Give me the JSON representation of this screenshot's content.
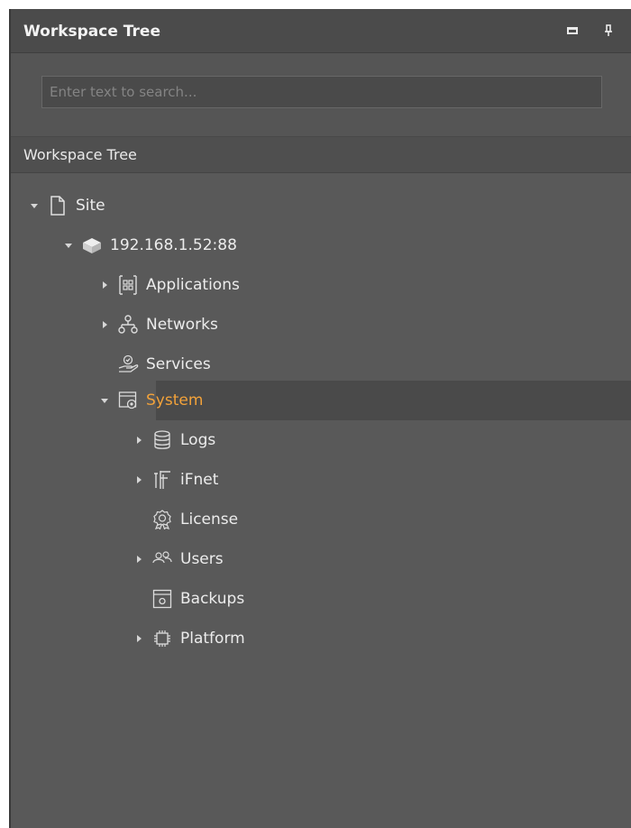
{
  "panel": {
    "title": "Workspace Tree",
    "restore_icon": "restore-icon",
    "pin_icon": "pin-icon"
  },
  "search": {
    "placeholder": "Enter text to search..."
  },
  "tree_header": "Workspace Tree",
  "colors": {
    "panel_bg": "#595959",
    "selected_text": "#f2a23a",
    "selected_row_bg": "#4a4a4a",
    "text": "#ececec"
  },
  "tree": {
    "site": {
      "label": "Site",
      "icon": "document-icon",
      "state": "expanded"
    },
    "server": {
      "label": "192.168.1.52:88",
      "icon": "server-icon",
      "state": "expanded"
    },
    "applications": {
      "label": "Applications",
      "icon": "grid-icon",
      "state": "collapsed"
    },
    "networks": {
      "label": "Networks",
      "icon": "network-icon",
      "state": "collapsed"
    },
    "services": {
      "label": "Services",
      "icon": "hand-icon"
    },
    "system": {
      "label": "System",
      "icon": "system-settings-icon",
      "state": "expanded",
      "selected": true
    },
    "logs": {
      "label": "Logs",
      "icon": "database-icon",
      "state": "collapsed"
    },
    "ifnet": {
      "label": "iFnet",
      "icon": "ifnet-icon",
      "state": "collapsed"
    },
    "license": {
      "label": "License",
      "icon": "badge-icon"
    },
    "users": {
      "label": "Users",
      "icon": "users-icon",
      "state": "collapsed"
    },
    "backups": {
      "label": "Backups",
      "icon": "save-icon"
    },
    "platform": {
      "label": "Platform",
      "icon": "chip-icon",
      "state": "collapsed"
    }
  }
}
